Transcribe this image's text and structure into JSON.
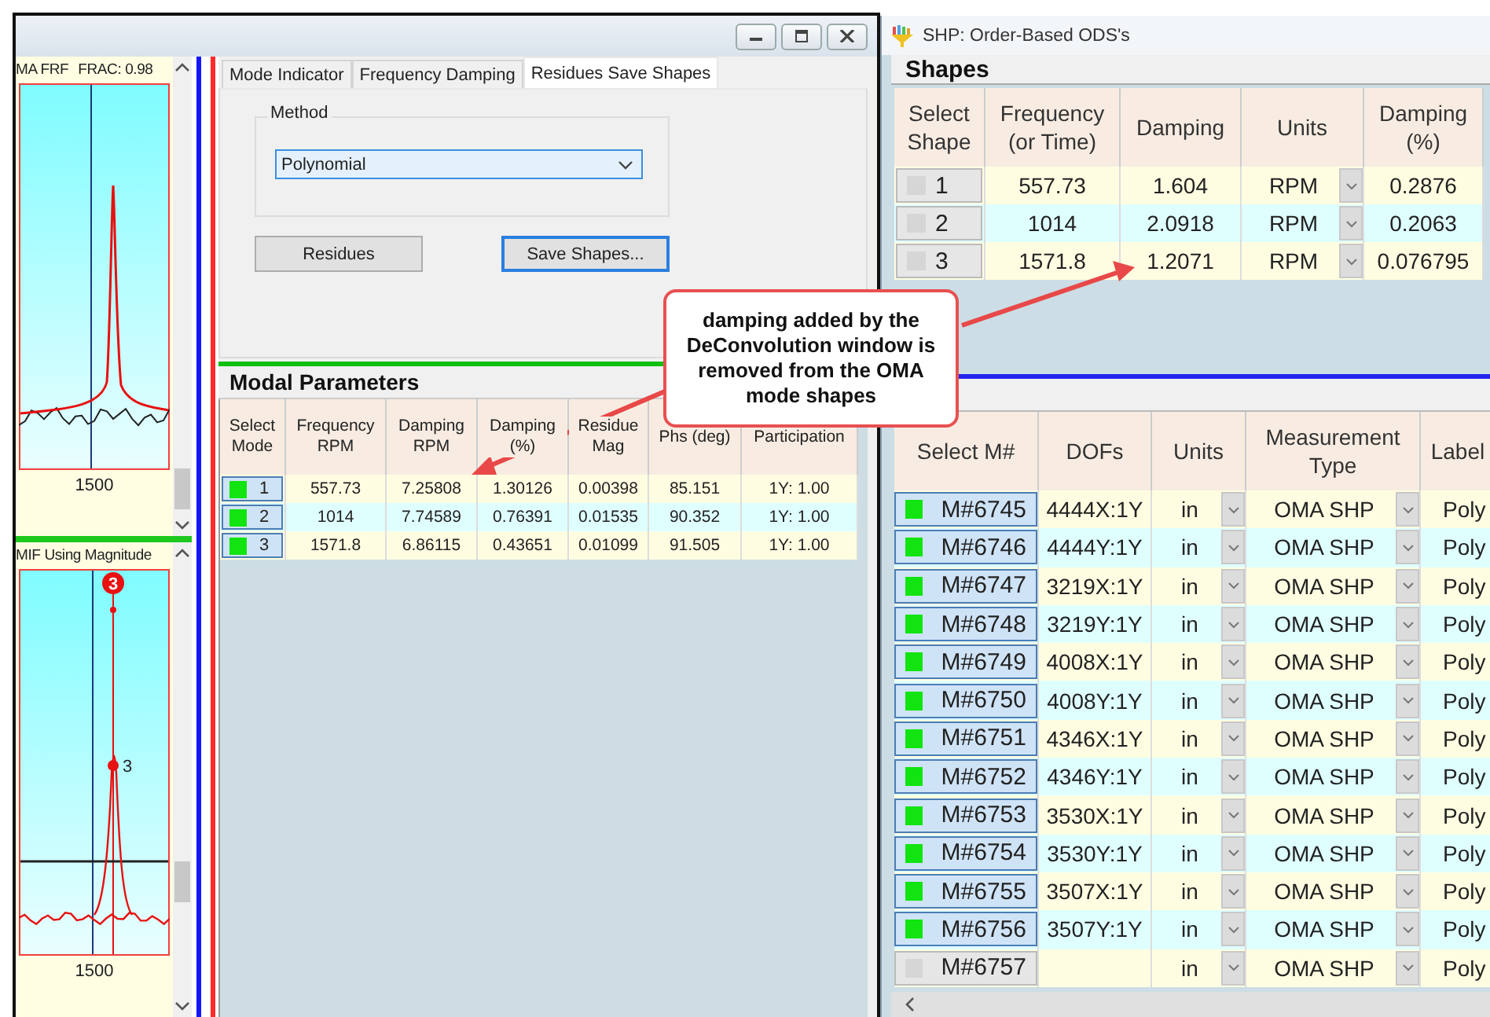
{
  "left_window": {
    "plots": [
      {
        "kind": "frf",
        "title": "MA FRF",
        "frac": "FRAC: 0.98",
        "x_label": "1500"
      },
      {
        "kind": "mif",
        "title": "MIF Using Magnitude",
        "x_label": "1500",
        "peak_badge": "3",
        "peak_label": "3"
      }
    ],
    "tabs": [
      {
        "label": "Mode Indicator",
        "selected": false
      },
      {
        "label": "Frequency Damping",
        "selected": false
      },
      {
        "label": "Residues Save Shapes",
        "selected": true
      }
    ],
    "method": {
      "label": "Method",
      "value": "Polynomial"
    },
    "buttons": [
      {
        "label": "Residues",
        "focused": false
      },
      {
        "label": "Save Shapes...",
        "focused": true
      }
    ],
    "modal_parameters": {
      "title": "Modal Parameters",
      "columns": [
        "Select Mode",
        "Frequency RPM",
        "Damping RPM",
        "Damping (%)",
        "Residue Mag",
        "Phs (deg)",
        "Participation"
      ],
      "rows": [
        {
          "mode": "1",
          "selected": true,
          "values": [
            "557.73",
            "7.25808",
            "1.30126",
            "0.00398",
            "85.151",
            "1Y: 1.00"
          ]
        },
        {
          "mode": "2",
          "selected": true,
          "values": [
            "1014",
            "7.74589",
            "0.76391",
            "0.01535",
            "90.352",
            "1Y: 1.00"
          ]
        },
        {
          "mode": "3",
          "selected": true,
          "values": [
            "1571.8",
            "6.86115",
            "0.43651",
            "0.01099",
            "91.505",
            "1Y: 1.00"
          ]
        }
      ]
    }
  },
  "callout": {
    "text": "damping added by the DeConvolution window is removed from the OMA mode shapes"
  },
  "shapes_window": {
    "title": "SHP: Order-Based ODS's",
    "shapes": {
      "title": "Shapes",
      "columns": [
        "Select Shape",
        "Frequency (or Time)",
        "Damping",
        "Units",
        "Damping (%)"
      ],
      "rows": [
        {
          "shape": "1",
          "selected": false,
          "frequency": "557.73",
          "damping": "1.604",
          "units": "RPM",
          "damping_pct": "0.2876"
        },
        {
          "shape": "2",
          "selected": false,
          "frequency": "1014",
          "damping": "2.0918",
          "units": "RPM",
          "damping_pct": "0.2063"
        },
        {
          "shape": "3",
          "selected": false,
          "frequency": "1571.8",
          "damping": "1.2071",
          "units": "RPM",
          "damping_pct": "0.076795"
        }
      ]
    },
    "measurements": {
      "columns": [
        "Select M#",
        "DOFs",
        "Units",
        "Measurement Type",
        "Label"
      ],
      "rows": [
        {
          "m": "M#6745",
          "selected": true,
          "dofs": "4444X:1Y",
          "units": "in",
          "type": "OMA SHP",
          "label": "Poly"
        },
        {
          "m": "M#6746",
          "selected": true,
          "dofs": "4444Y:1Y",
          "units": "in",
          "type": "OMA SHP",
          "label": "Poly"
        },
        {
          "m": "M#6747",
          "selected": true,
          "dofs": "3219X:1Y",
          "units": "in",
          "type": "OMA SHP",
          "label": "Poly"
        },
        {
          "m": "M#6748",
          "selected": true,
          "dofs": "3219Y:1Y",
          "units": "in",
          "type": "OMA SHP",
          "label": "Poly"
        },
        {
          "m": "M#6749",
          "selected": true,
          "dofs": "4008X:1Y",
          "units": "in",
          "type": "OMA SHP",
          "label": "Poly"
        },
        {
          "m": "M#6750",
          "selected": true,
          "dofs": "4008Y:1Y",
          "units": "in",
          "type": "OMA SHP",
          "label": "Poly"
        },
        {
          "m": "M#6751",
          "selected": true,
          "dofs": "4346X:1Y",
          "units": "in",
          "type": "OMA SHP",
          "label": "Poly"
        },
        {
          "m": "M#6752",
          "selected": true,
          "dofs": "4346Y:1Y",
          "units": "in",
          "type": "OMA SHP",
          "label": "Poly"
        },
        {
          "m": "M#6753",
          "selected": true,
          "dofs": "3530X:1Y",
          "units": "in",
          "type": "OMA SHP",
          "label": "Poly"
        },
        {
          "m": "M#6754",
          "selected": true,
          "dofs": "3530Y:1Y",
          "units": "in",
          "type": "OMA SHP",
          "label": "Poly"
        },
        {
          "m": "M#6755",
          "selected": true,
          "dofs": "3507X:1Y",
          "units": "in",
          "type": "OMA SHP",
          "label": "Poly"
        },
        {
          "m": "M#6756",
          "selected": true,
          "dofs": "3507Y:1Y",
          "units": "in",
          "type": "OMA SHP",
          "label": "Poly"
        },
        {
          "m": "M#6757",
          "selected": false,
          "units": "in",
          "type": "OMA SHP",
          "label": "Poly"
        }
      ]
    }
  }
}
